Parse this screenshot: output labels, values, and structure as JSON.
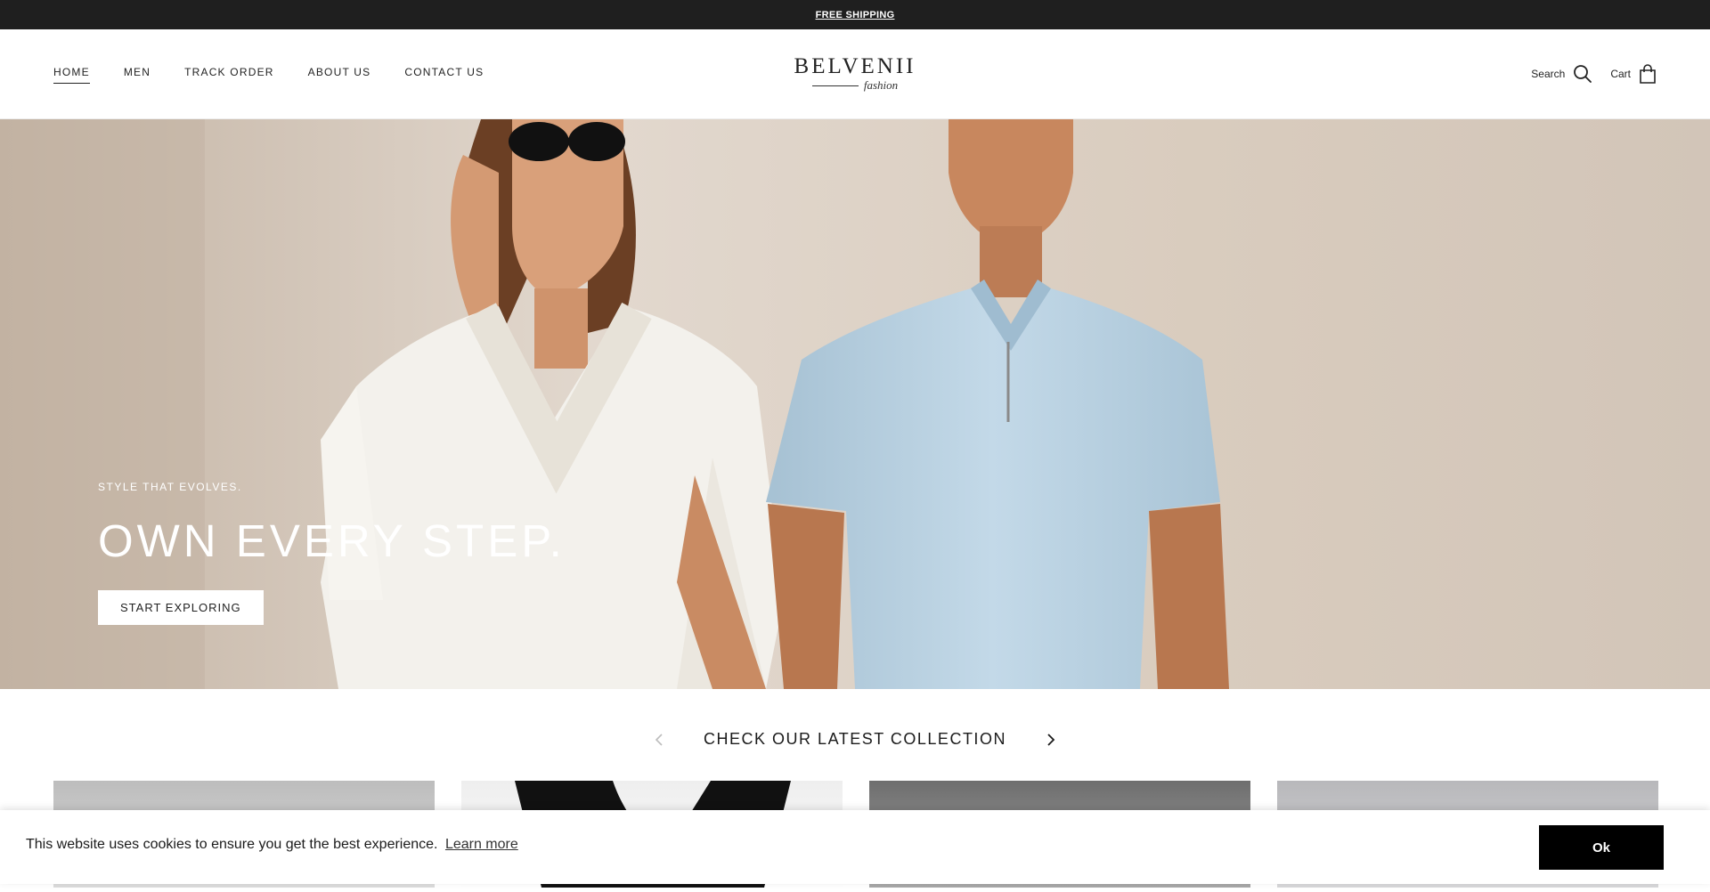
{
  "announcement": {
    "text": "FREE SHIPPING"
  },
  "header": {
    "nav": [
      {
        "label": "HOME",
        "active": true
      },
      {
        "label": "MEN"
      },
      {
        "label": "TRACK ORDER"
      },
      {
        "label": "ABOUT US"
      },
      {
        "label": "CONTACT US"
      }
    ],
    "logo": {
      "brand": "BELVENII",
      "sub": "fashion"
    },
    "search_label": "Search",
    "cart_label": "Cart"
  },
  "hero": {
    "eyebrow": "STYLE THAT EVOLVES.",
    "headline": "OWN EVERY STEP.",
    "cta": "START EXPLORING"
  },
  "collection": {
    "title": "CHECK OUR LATEST COLLECTION"
  },
  "cookie": {
    "message": "This website uses cookies to ensure you get the best experience.",
    "learn_more": "Learn more",
    "ok_label": "Ok"
  },
  "colors": {
    "announcement_bg": "#1f1f1f",
    "hero_bg": "#d9cdc1",
    "shirt_blue": "#b8d2e3",
    "cookie_button": "#000000"
  },
  "icons": [
    "search-icon",
    "bag-icon",
    "chevron-left-icon",
    "chevron-right-icon"
  ]
}
